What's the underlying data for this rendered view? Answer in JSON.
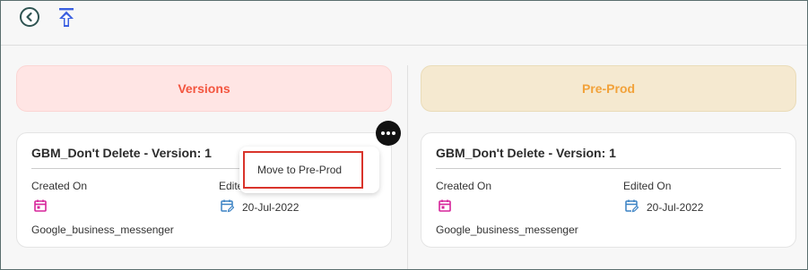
{
  "toolbar": {
    "back_icon": "chevron-left-circle-icon",
    "upload_icon": "upload-arrow-icon"
  },
  "stages": [
    {
      "label": "Versions",
      "color": "#f3553f",
      "bg": "#ffe5e4"
    },
    {
      "label": "Pre-Prod",
      "color": "#f2a23a",
      "bg": "#f5e9d0"
    }
  ],
  "cards": [
    {
      "title": "GBM_Don't Delete - Version: 1",
      "created_label": "Created On",
      "edited_label": "Edited On",
      "created_icon": "calendar-icon",
      "edited_icon": "calendar-edit-icon",
      "edited_date": "20-Jul-2022",
      "channel": "Google_business_messenger"
    },
    {
      "title": "GBM_Don't Delete - Version: 1",
      "created_label": "Created On",
      "edited_label": "Edited On",
      "created_icon": "calendar-icon",
      "edited_icon": "calendar-edit-icon",
      "edited_date": "20-Jul-2022",
      "channel": "Google_business_messenger"
    }
  ],
  "more_menu": {
    "icon": "more-horizontal-icon",
    "items": [
      {
        "label": "Move to Pre-Prod"
      }
    ]
  },
  "colors": {
    "icon_magenta": "#d6249a",
    "icon_blue": "#3b82c4",
    "upload_blue": "#3a5fe0",
    "highlight_red": "#d9342b"
  }
}
